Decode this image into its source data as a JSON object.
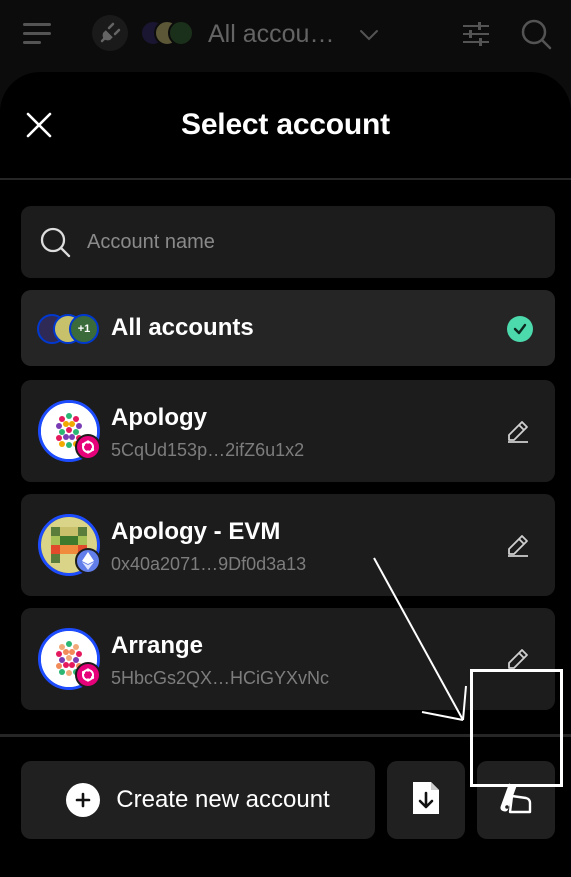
{
  "topbar": {
    "account_selector_label": "All accou…"
  },
  "modal": {
    "title": "Select account",
    "search": {
      "placeholder": "Account name",
      "value": ""
    },
    "all_accounts": {
      "label": "All accounts",
      "badge": "+1",
      "selected": true
    },
    "accounts": [
      {
        "name": "Apology",
        "address": "5CqUd153p…2ifZ6u1x2",
        "chain": "polkadot",
        "chain_color": "#e6007a"
      },
      {
        "name": "Apology - EVM",
        "address": "0x40a2071…9Df0d3a13",
        "chain": "ethereum",
        "chain_color": "#627eea"
      },
      {
        "name": "Arrange",
        "address": "5HbcGs2QX…HCiGYXvNc",
        "chain": "polkadot",
        "chain_color": "#e6007a"
      }
    ],
    "footer": {
      "create_label": "Create new account",
      "import_icon": "file-download-icon",
      "theme_icon": "swatch-icon"
    }
  },
  "colors": {
    "background": "#000000",
    "card": "#1c1c1c",
    "selected_card": "#252525",
    "accent_check": "#4cd9ac",
    "avatar_ring": "#1d4cff",
    "muted_text": "#7d7d7d"
  }
}
